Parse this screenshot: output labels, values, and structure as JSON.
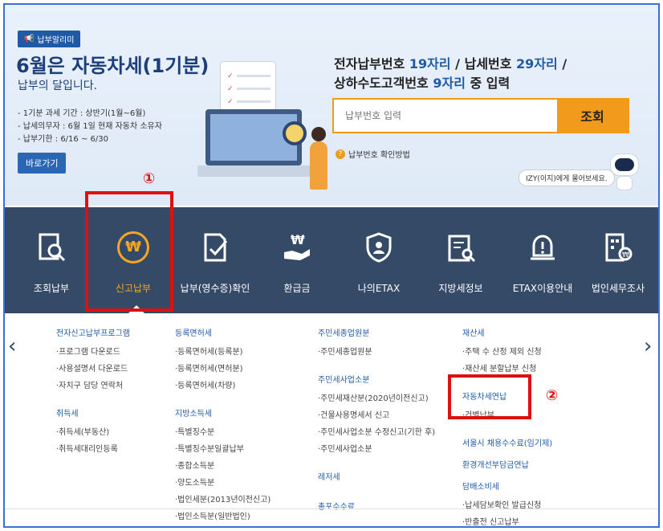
{
  "banner": {
    "tag": "납부알리미",
    "title": "6월은 자동차세(1기분)",
    "subtitle": "납부의 달입니다.",
    "info": [
      "- 1기분 과세 기간 : 상반기(1월~6월)",
      "- 납세의무자 : 6월 1일 현재 자동차 소유자",
      "- 납부기한 : 6/16 ~ 6/30"
    ],
    "go_label": "바로가기"
  },
  "search": {
    "line1_a": "전자납부번호 ",
    "line1_b": "19자리",
    "line1_c": " / 납세번호 ",
    "line1_d": "29자리",
    "line1_e": " /",
    "line2_a": "상하수도고객번호 ",
    "line2_b": "9자리",
    "line2_c": " 중 입력",
    "placeholder": "납부번호 입력",
    "button": "조회",
    "help": "납부번호 확인방법",
    "izy": "IZY(이지)에게 물어보세요."
  },
  "nav": {
    "items": [
      {
        "label": "조회납부",
        "icon": "search-doc-icon"
      },
      {
        "label": "신고납부",
        "icon": "won-coin-icon"
      },
      {
        "label": "납부(영수증)확인",
        "icon": "doc-check-icon"
      },
      {
        "label": "환급금",
        "icon": "refund-hand-icon"
      },
      {
        "label": "나의ETAX",
        "icon": "user-shield-icon"
      },
      {
        "label": "지방세정보",
        "icon": "calendar-search-icon"
      },
      {
        "label": "ETAX이용안내",
        "icon": "alert-bell-icon"
      },
      {
        "label": "법인세무조사",
        "icon": "building-won-icon"
      }
    ]
  },
  "menu": {
    "col1": {
      "cat1": "전자신고납부프로그램",
      "items1": [
        "·프로그램 다운로드",
        "·사용설명서 다운로드",
        "·자치구 담당 연락처"
      ],
      "cat2": "취득세",
      "items2": [
        "·취득세(부동산)",
        "·취득세대리인등록"
      ]
    },
    "col2": {
      "cat1": "등록면허세",
      "items1": [
        "·등록면허세(등록분)",
        "·등록면허세(면허분)",
        "·등록면허세(차량)"
      ],
      "cat2": "지방소득세",
      "items2": [
        "·특별징수분",
        "·특별징수분일괄납부",
        "·종합소득분",
        "·양도소득분",
        "·법인세분(2013년이전신고)",
        "·법인소득분(일반법인)"
      ]
    },
    "col3": {
      "cat1": "주민세종업원분",
      "items1": [
        "·주민세종업원분"
      ],
      "cat2": "주민세사업소분",
      "items2": [
        "·주민세재산분(2020년이전신고)",
        "·건물사용명세서 신고",
        "·주민세사업소분 수정신고(기한 후)",
        "·주민세사업소분"
      ],
      "cat3": "레저세",
      "cat4": "총포수수료"
    },
    "col4": {
      "cat1": "재산세",
      "items1": [
        "·주택 수 산정 제외 신청",
        "·재산세 분할납부 신청"
      ],
      "cat2": "자동차세연납",
      "items2": [
        "·건별납부"
      ],
      "cat3": "서울시 채용수수료(임기제)",
      "cat4": "환경개선부담금연납",
      "cat5": "담배소비세",
      "items5": [
        "·납세담보확인 발급신청",
        "·반출전 신고납부"
      ]
    }
  },
  "annotations": {
    "one": "①",
    "two": "②"
  }
}
